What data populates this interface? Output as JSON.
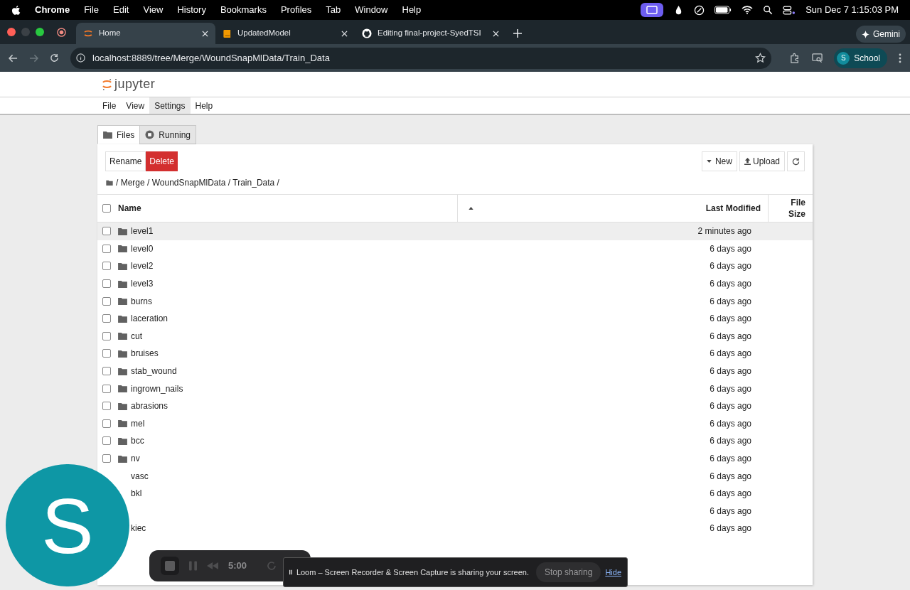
{
  "mac_menu": {
    "app": "Chrome",
    "items": [
      "File",
      "Edit",
      "View",
      "History",
      "Bookmarks",
      "Profiles",
      "Tab",
      "Window",
      "Help"
    ],
    "clock": "Sun Dec 7  1:15:03 PM"
  },
  "browser_tabs": [
    {
      "title": "Home",
      "selected": true
    },
    {
      "title": "UpdatedModel",
      "selected": false
    },
    {
      "title": "Editing final-project-SyedTSI",
      "selected": false
    }
  ],
  "gemini": "Gemini",
  "address": "localhost:8889/tree/Merge/WoundSnapMlData/Train_Data",
  "profile": {
    "initial": "S",
    "name": "School"
  },
  "jupyter": {
    "logo": "jupyter",
    "menu": [
      {
        "label": "File",
        "selected": false
      },
      {
        "label": "View",
        "selected": false
      },
      {
        "label": "Settings",
        "selected": true
      },
      {
        "label": "Help",
        "selected": false
      }
    ],
    "tabs": [
      {
        "label": "Files",
        "selected": true
      },
      {
        "label": "Running",
        "selected": false
      }
    ],
    "actions": [
      {
        "label": "Rename",
        "kind": "plain"
      },
      {
        "label": "Delete",
        "kind": "danger"
      }
    ],
    "tools": [
      {
        "label": "New",
        "kind": "new"
      },
      {
        "label": "Upload",
        "kind": "upload"
      },
      {
        "kind": "refresh"
      }
    ],
    "select_all": {
      "checked": false
    },
    "breadcrumb": "/ Merge / WoundSnapMlData / Train_Data /",
    "columns": [
      "Name",
      "Last Modified",
      "File Size"
    ],
    "rows": [
      {
        "name": "level1",
        "modified": "2 minutes ago",
        "selected": true,
        "checked": false
      },
      {
        "name": "level0",
        "modified": "6 days ago",
        "selected": false,
        "checked": false
      },
      {
        "name": "level2",
        "modified": "6 days ago",
        "selected": false,
        "checked": false
      },
      {
        "name": "level3",
        "modified": "6 days ago",
        "selected": false,
        "checked": false
      },
      {
        "name": "burns",
        "modified": "6 days ago",
        "selected": false,
        "checked": false
      },
      {
        "name": "laceration",
        "modified": "6 days ago",
        "selected": false,
        "checked": false
      },
      {
        "name": "cut",
        "modified": "6 days ago",
        "selected": false,
        "checked": false
      },
      {
        "name": "bruises",
        "modified": "6 days ago",
        "selected": false,
        "checked": false
      },
      {
        "name": "stab_wound",
        "modified": "6 days ago",
        "selected": false,
        "checked": false
      },
      {
        "name": "ingrown_nails",
        "modified": "6 days ago",
        "selected": false,
        "checked": false
      },
      {
        "name": "abrasions",
        "modified": "6 days ago",
        "selected": false,
        "checked": false
      },
      {
        "name": "mel",
        "modified": "6 days ago",
        "selected": false,
        "checked": false
      },
      {
        "name": "bcc",
        "modified": "6 days ago",
        "selected": false,
        "checked": false
      },
      {
        "name": "nv",
        "modified": "6 days ago",
        "selected": false,
        "checked": false
      },
      {
        "name": "vasc",
        "modified": "6 days ago",
        "selected": false
      },
      {
        "name": "bkl",
        "modified": "6 days ago",
        "selected": false
      },
      {
        "modified": "6 days ago",
        "selected": false
      },
      {
        "name": "kiec",
        "modified": "6 days ago",
        "selected": false
      }
    ]
  },
  "recorder": {
    "avatar": "S",
    "timer": "5:00"
  },
  "share_bar": {
    "message": "Loom – Screen Recorder & Screen Capture is sharing your screen.",
    "stop": "Stop sharing",
    "hide": "Hide"
  }
}
